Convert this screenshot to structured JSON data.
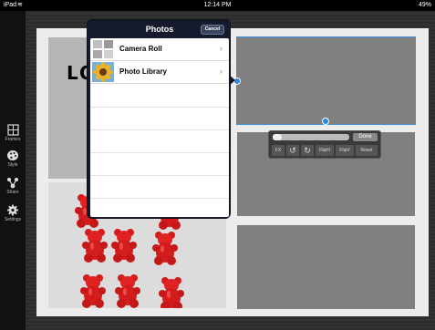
{
  "status_bar": {
    "device": "iPad",
    "time": "12:14 PM",
    "battery": "49%"
  },
  "toolbar": {
    "items": [
      {
        "label": "Frames",
        "icon": "frames-icon"
      },
      {
        "label": "Style",
        "icon": "palette-icon"
      },
      {
        "label": "Share",
        "icon": "share-icon"
      },
      {
        "label": "Settings",
        "icon": "gear-icon"
      }
    ]
  },
  "collage": {
    "photo_text": "LOO"
  },
  "edit_bar": {
    "done_label": "Done",
    "buttons": [
      "FX",
      "FlipH",
      "FlipV",
      "Reset"
    ]
  },
  "popover": {
    "title": "Photos",
    "cancel_label": "Cancel",
    "rows": [
      {
        "label": "Camera Roll",
        "thumb": "camera-roll-thumbnail"
      },
      {
        "label": "Photo Library",
        "thumb": "sunflower-thumbnail"
      }
    ]
  },
  "colors": {
    "selection": "#3b8fe0",
    "popover_bg": "#151b2c",
    "bear_red": "#d41c1c"
  }
}
